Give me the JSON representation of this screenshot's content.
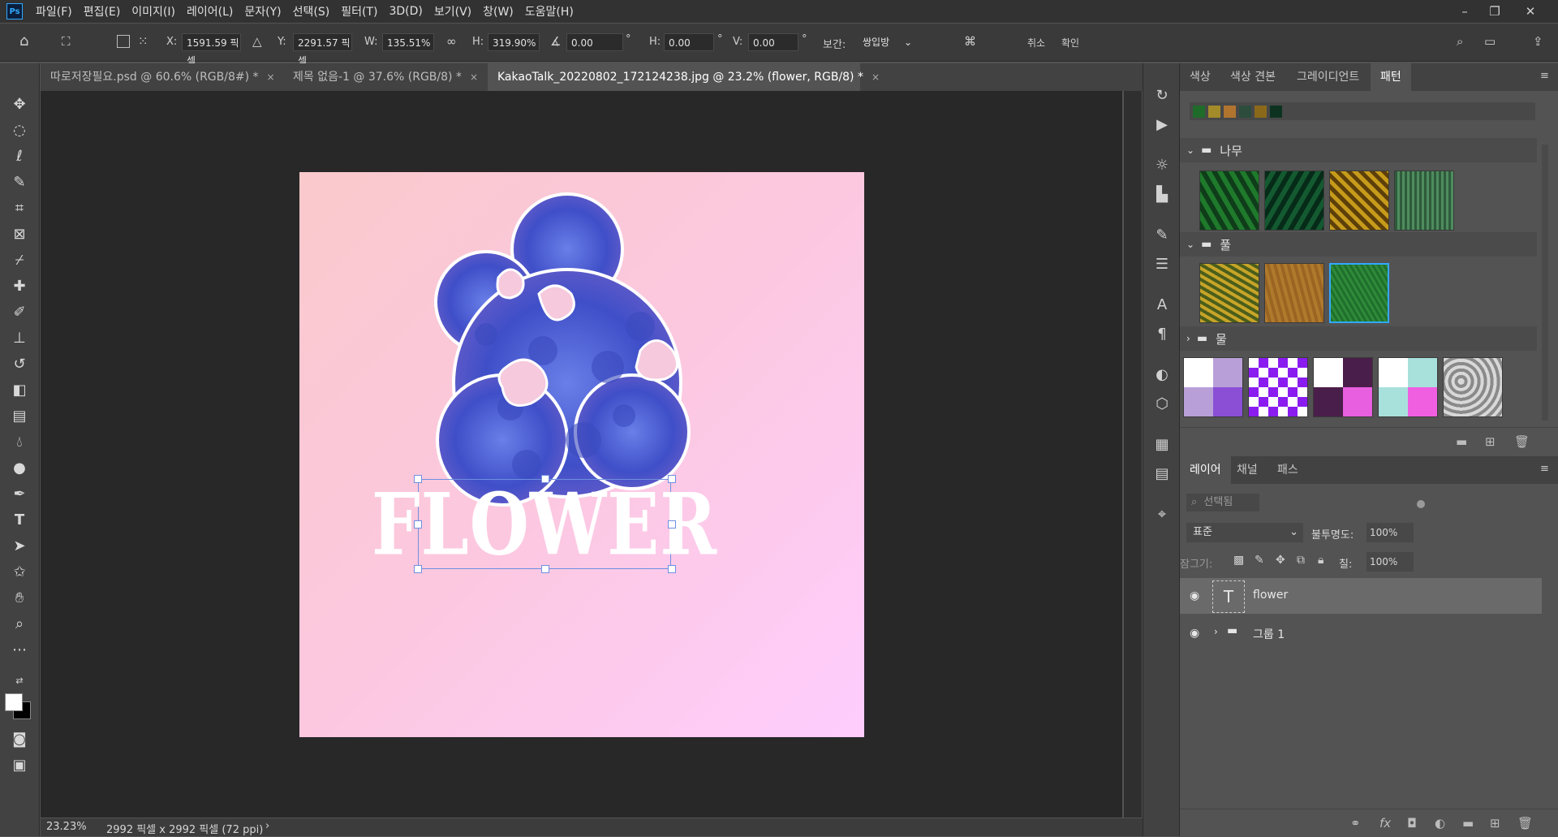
{
  "app": {
    "logo": "Ps"
  },
  "menu": [
    "파일(F)",
    "편집(E)",
    "이미지(I)",
    "레이어(L)",
    "문자(Y)",
    "선택(S)",
    "필터(T)",
    "3D(D)",
    "보기(V)",
    "창(W)",
    "도움말(H)"
  ],
  "window_controls": {
    "minimize": "–",
    "restore": "❐",
    "close": "✕"
  },
  "options": {
    "x_label": "X:",
    "x_value": "1591.59 픽셀",
    "y_label": "Y:",
    "y_value": "2291.57 픽셀",
    "w_label": "W:",
    "w_value": "135.51%",
    "h_label": "H:",
    "h_value": "319.90%",
    "angle_value": "0.00",
    "degree": "°",
    "hskew_label": "H:",
    "hskew_value": "0.00",
    "vskew_label": "V:",
    "vskew_value": "0.00",
    "interp_label": "보간:",
    "interp_value": "쌍입방",
    "cancel_label": "취소",
    "confirm_label": "확인"
  },
  "tabs": [
    {
      "label": "따로저장필요.psd @ 60.6% (RGB/8#) *",
      "close": "×"
    },
    {
      "label": "제목 없음-1 @ 37.6% (RGB/8) *",
      "close": "×"
    },
    {
      "label": "KakaoTalk_20220802_172124238.jpg @ 23.2% (flower, RGB/8) *",
      "close": "×"
    }
  ],
  "canvas": {
    "text": "FLOWER"
  },
  "status": {
    "zoom": "23.23%",
    "doc_info": "2992 픽셀 x 2992 픽셀 (72 ppi)",
    "arrow": "›"
  },
  "pattern_panel": {
    "tabs": [
      "색상",
      "색상 견본",
      "그레이디언트",
      "패턴"
    ],
    "active_tab": 3,
    "groups": [
      {
        "name": "나무",
        "expanded": true
      },
      {
        "name": "풀",
        "expanded": true
      },
      {
        "name": "물",
        "expanded": false
      }
    ]
  },
  "layers_panel": {
    "tabs": [
      "레이어",
      "채널",
      "패스"
    ],
    "filter_placeholder": "선택됨",
    "blend_mode": "표준",
    "opacity_label": "불투명도:",
    "opacity_value": "100%",
    "lock_label": "잠그기:",
    "fill_label": "칠:",
    "fill_value": "100%",
    "layers": [
      {
        "name": "flower",
        "type": "text",
        "thumb": "T"
      },
      {
        "name": "그룹 1",
        "type": "group"
      }
    ]
  },
  "colors": {
    "accent": "#31a8ff",
    "selection": "#6f8fe0"
  }
}
